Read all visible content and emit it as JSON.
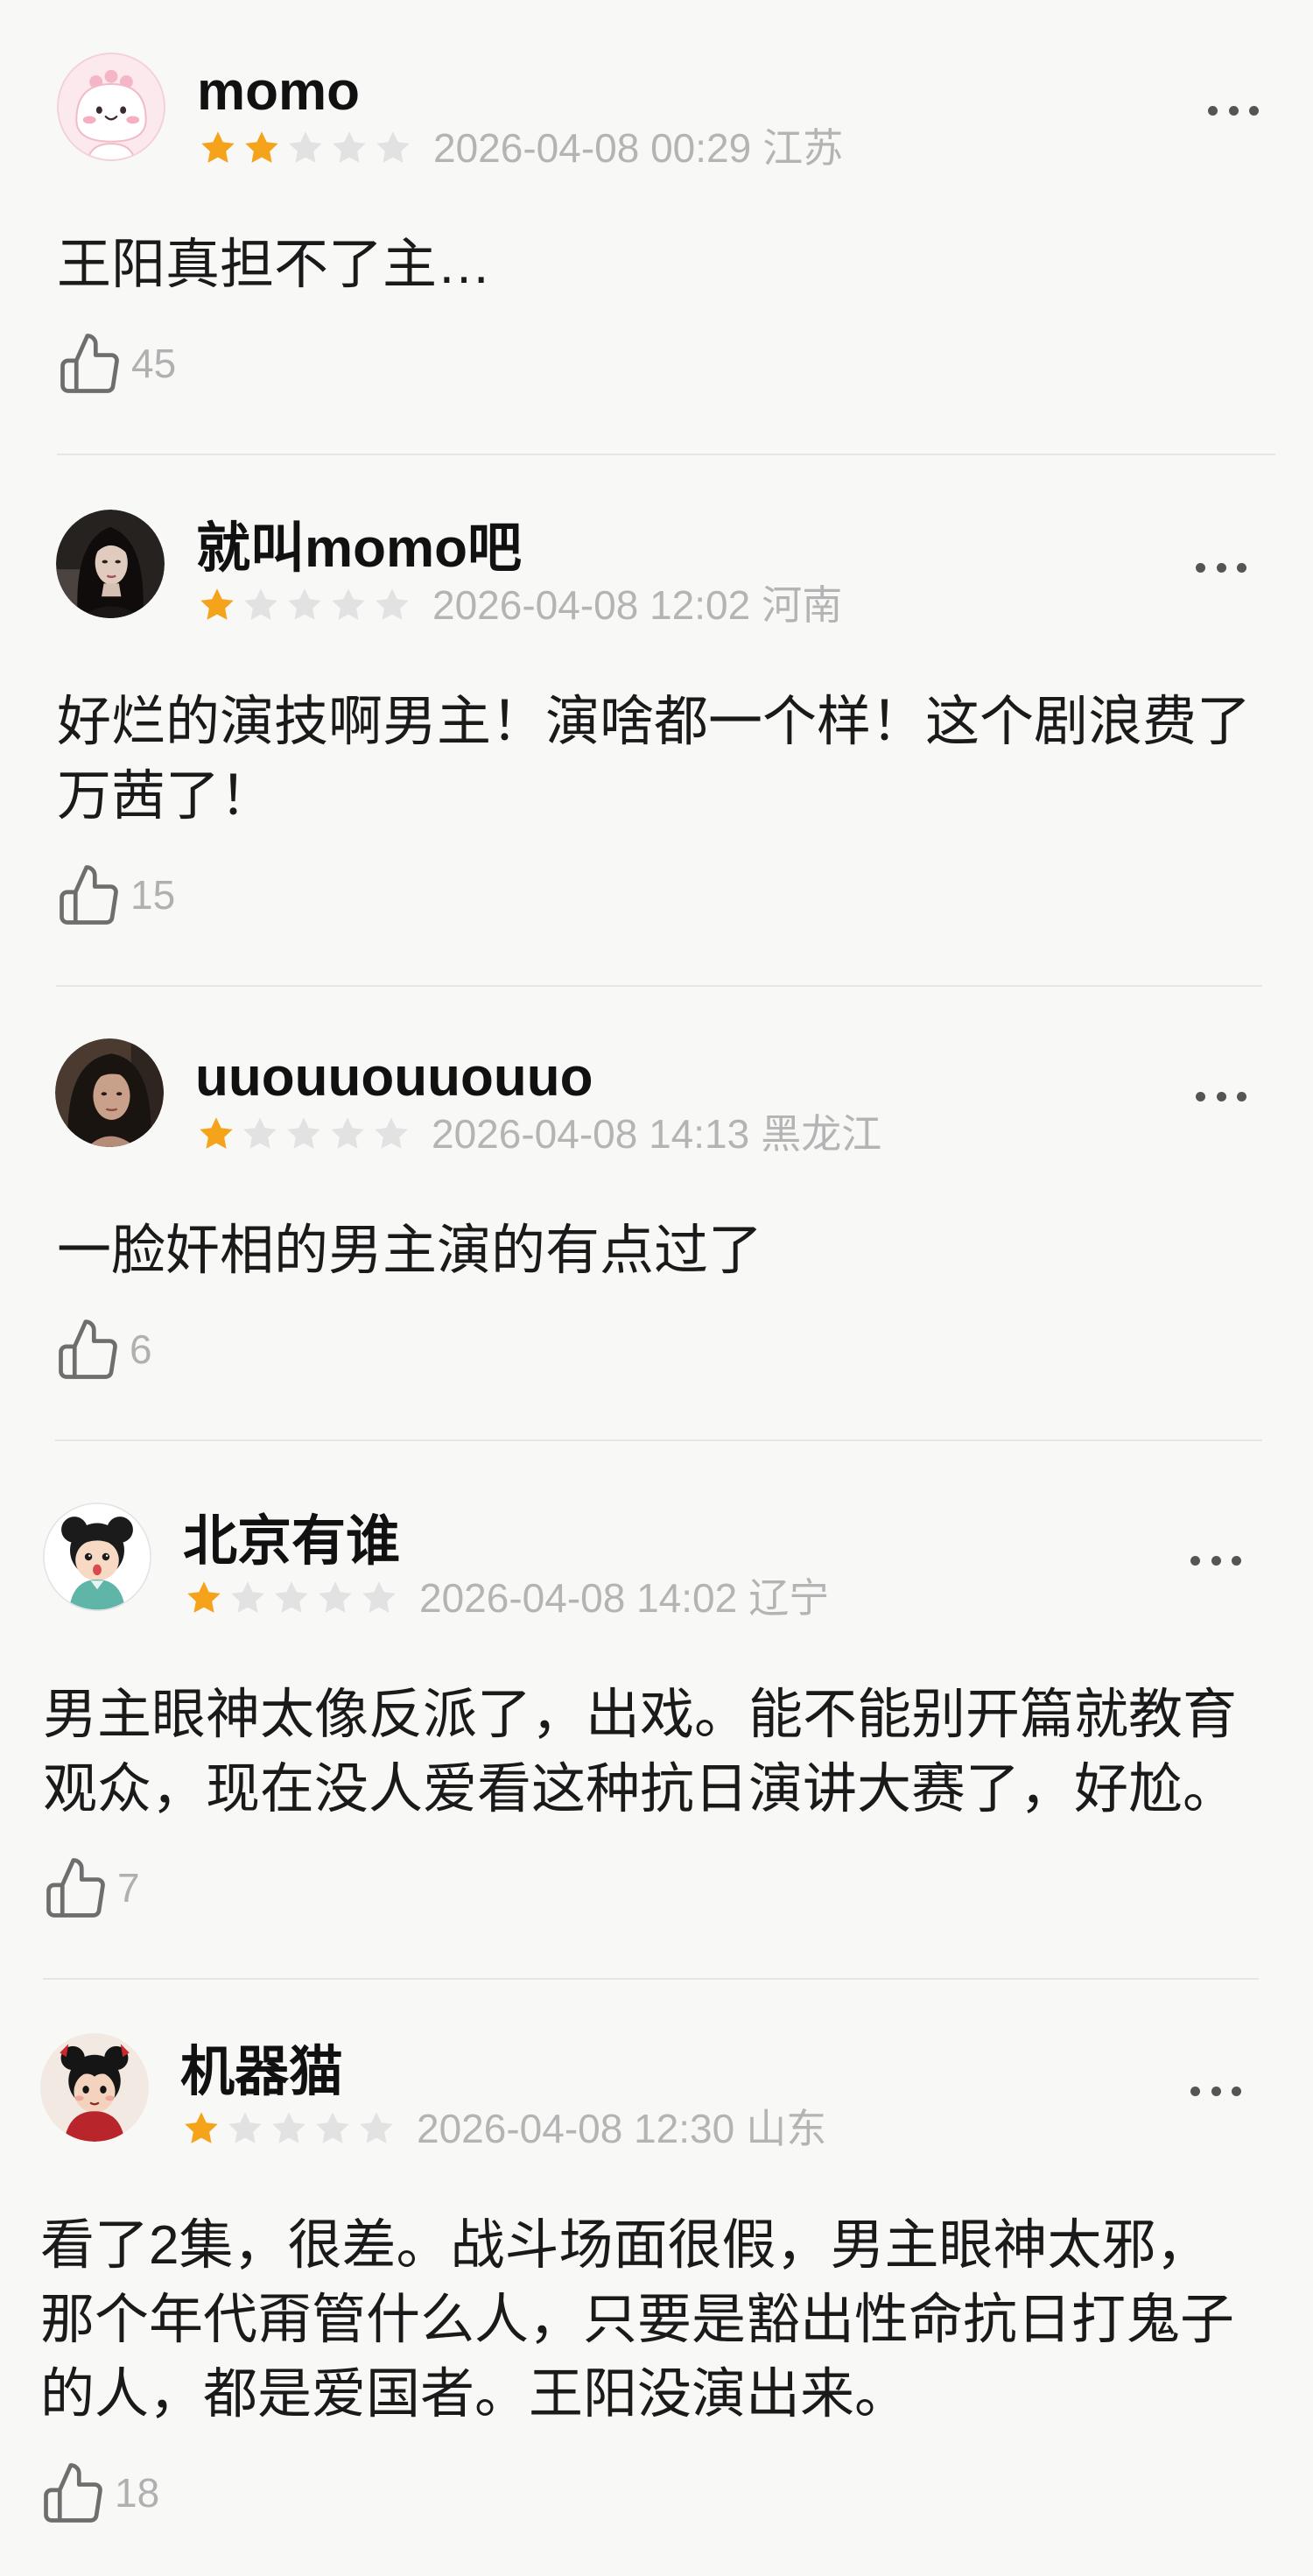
{
  "comments": [
    {
      "username": "momo",
      "rating": 2,
      "date": "2026-04-08 00:29",
      "location": "江苏",
      "text_lines": [
        "王阳真担不了主…"
      ],
      "likes": 45
    },
    {
      "username": "就叫momo吧",
      "rating": 1,
      "date": "2026-04-08 12:02",
      "location": "河南",
      "text_lines": [
        "好烂的演技啊男主！演啥都一个样！这个剧浪费了",
        "万茜了！"
      ],
      "likes": 15
    },
    {
      "username": "uuouuouuouuo",
      "rating": 1,
      "date": "2026-04-08 14:13",
      "location": "黑龙江",
      "text_lines": [
        "一脸奸相的男主演的有点过了"
      ],
      "likes": 6
    },
    {
      "username": "北京有谁",
      "rating": 1,
      "date": "2026-04-08 14:02",
      "location": "辽宁",
      "text_lines": [
        "男主眼神太像反派了，出戏。能不能别开篇就教育",
        "观众，现在没人爱看这种抗日演讲大赛了，好尬。"
      ],
      "likes": 7
    },
    {
      "username": "机器猫",
      "rating": 1,
      "date": "2026-04-08 12:30",
      "location": "山东",
      "text_lines": [
        "看了2集，很差。战斗场面很假，男主眼神太邪，",
        "那个年代甭管什么人，只要是豁出性命抗日打鬼子",
        "的人，都是爱国者。王阳没演出来。"
      ],
      "likes": 18
    }
  ],
  "icons": {
    "like": "thumbs-up-icon",
    "more": "more-dots-icon",
    "star": "star-icon"
  },
  "colors": {
    "background": "#F8F8F6",
    "star_filled": "#F6A31C",
    "star_empty": "#E2E2E2",
    "text": "#1A1A1A",
    "meta": "#B4B4B4",
    "divider": "#E6E6E6"
  }
}
